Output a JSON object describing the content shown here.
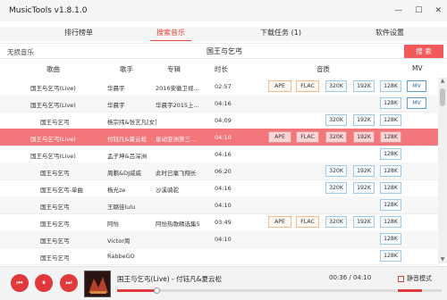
{
  "window": {
    "title": "MusicTools v1.8.1.0",
    "minimize": "—",
    "maximize": "☐",
    "close": "✕"
  },
  "tabs": [
    {
      "label": "排行榜单",
      "active": false
    },
    {
      "label": "搜索音乐",
      "active": true
    },
    {
      "label": "下载任务 (1)",
      "active": false
    },
    {
      "label": "软件设置",
      "active": false
    }
  ],
  "search": {
    "lossless_label": "无损音乐",
    "query": "国王与乞丐",
    "button": "搜 索"
  },
  "columns": {
    "title": "歌曲",
    "artist": "歌手",
    "album": "专辑",
    "duration": "时长",
    "quality": "音质",
    "mv": "MV"
  },
  "rows": [
    {
      "title": "国王与乞丐(Live)",
      "artist": "华晨宇",
      "album": "2016安徽卫视...",
      "duration": "02:57",
      "q": [
        "APE",
        "FLAC",
        "320K",
        "192K",
        "128K"
      ],
      "mv": "MV"
    },
    {
      "title": "国王与乞丐(Live)",
      "artist": "华晨宇",
      "album": "华晨宇2015上...",
      "duration": "04:16",
      "q": [
        "",
        "",
        "",
        "",
        "128K"
      ],
      "mv": "MV"
    },
    {
      "title": "国王与乞丐",
      "artist": "杨宗纬&张艺凡[女]",
      "album": "",
      "duration": "04:09",
      "q": [
        "",
        "",
        "320K",
        "192K",
        "128K"
      ],
      "mv": ""
    },
    {
      "title": "国王与乞丐(Live)",
      "artist": "付钰凡&夏云松",
      "album": "星动亚洲第三...",
      "duration": "04:10",
      "q": [
        "APE",
        "FLAC",
        "320K",
        "192K",
        "128K"
      ],
      "mv": "",
      "selected": true
    },
    {
      "title": "国王与乞丐(Live)",
      "artist": "孟子坤&吕深洲",
      "album": "",
      "duration": "04:16",
      "q": [
        "",
        "",
        "",
        "",
        "128K"
      ],
      "mv": ""
    },
    {
      "title": "国王与乞丐",
      "artist": "周鹏&DJ威威",
      "album": "此时已毫飞翔长",
      "duration": "06:20",
      "q": [
        "",
        "",
        "320K",
        "192K",
        "128K"
      ],
      "mv": ""
    },
    {
      "title": "国王与乞丐-单曲",
      "artist": "杨光ze",
      "album": "沙溪骑驼",
      "duration": "04:16",
      "q": [
        "",
        "",
        "320K",
        "192K",
        "128K"
      ],
      "mv": ""
    },
    {
      "title": "国王与乞丐",
      "artist": "王璐佳lulu",
      "album": "",
      "duration": "04:10",
      "q": [
        "",
        "",
        "",
        "",
        "128K"
      ],
      "mv": ""
    },
    {
      "title": "国王与乞丐",
      "artist": "阿怡",
      "album": "阿怡热歌精选集5",
      "duration": "03:49",
      "q": [
        "APE",
        "FLAC",
        "320K",
        "192K",
        "128K"
      ],
      "mv": ""
    },
    {
      "title": "国王与乞丐",
      "artist": "Victor周",
      "album": "",
      "duration": "04:10",
      "q": [
        "",
        "",
        "",
        "",
        "128K"
      ],
      "mv": ""
    },
    {
      "title": "国王与乞丐",
      "artist": "RabbeGO",
      "album": "",
      "duration": "",
      "q": [
        "",
        "",
        "",
        "",
        "128K"
      ],
      "mv": ""
    }
  ],
  "player": {
    "now_playing": "国王与乞丐(Live) - 付钰凡&夏云松",
    "time": "00:36 / 04:10",
    "progress": 0.14,
    "mute_label": "静音模式",
    "volume": 0.55,
    "prev": "⏮",
    "pause": "⏸",
    "next": "⏭"
  }
}
